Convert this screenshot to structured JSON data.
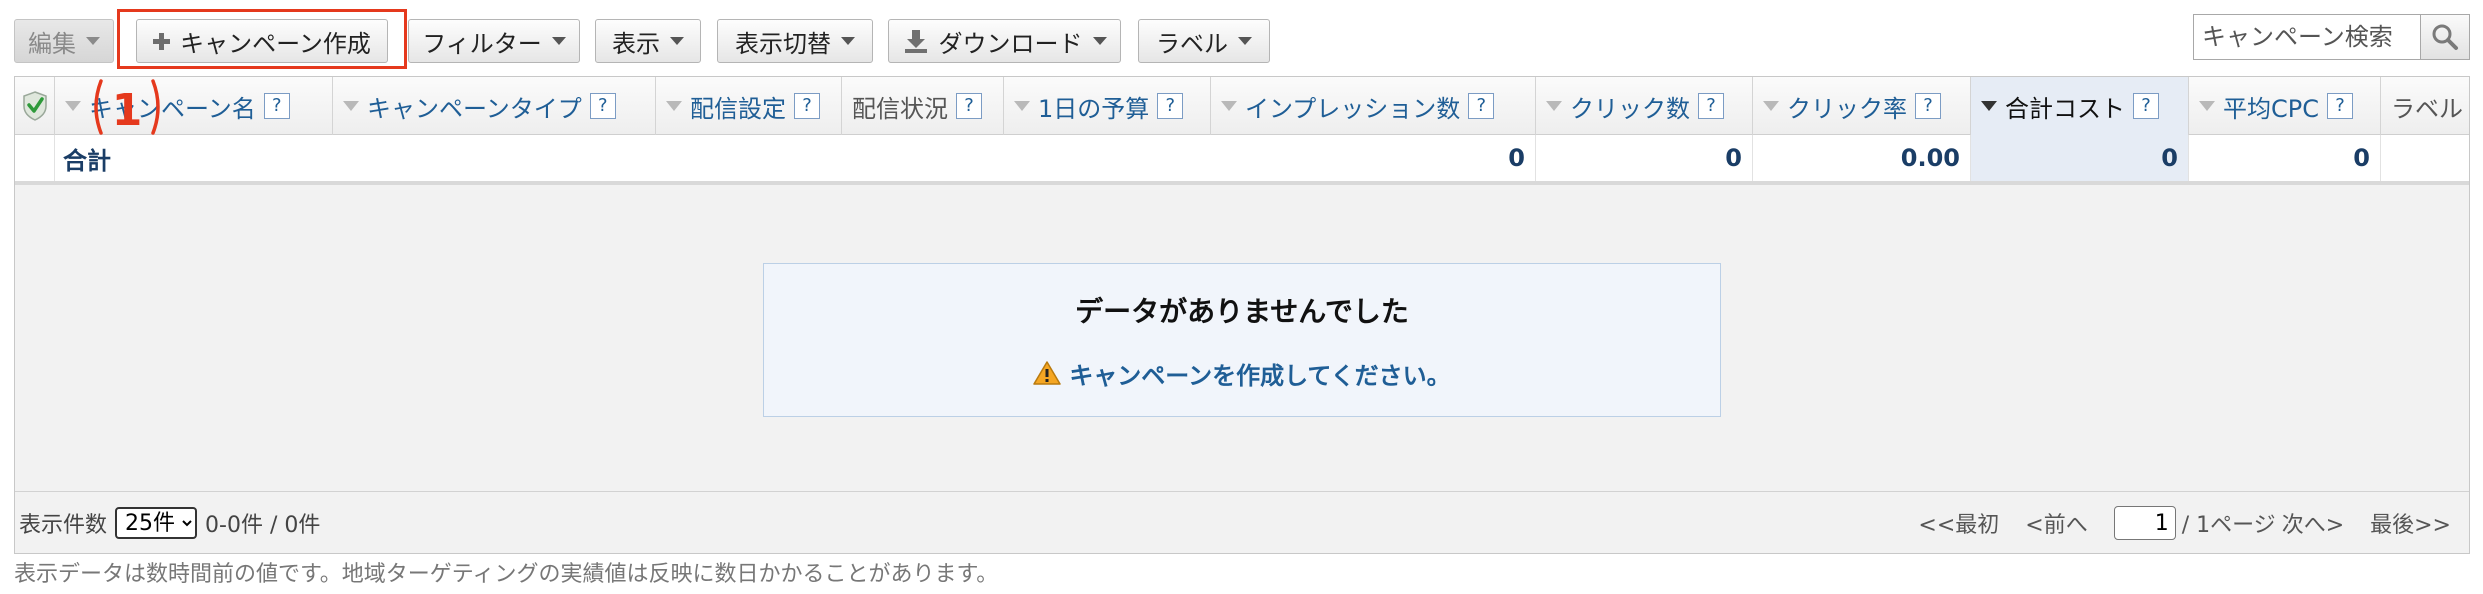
{
  "toolbar": {
    "edit_label": "編集",
    "create_campaign_label": "キャンペーン作成",
    "filter_label": "フィルター",
    "display_label": "表示",
    "view_switch_label": "表示切替",
    "download_label": "ダウンロード",
    "label_label": "ラベル",
    "search_placeholder": "キャンペーン検索"
  },
  "callout_number": "1",
  "columns": [
    {
      "label": "キャンペーン名",
      "help": "?"
    },
    {
      "label": "キャンペーンタイプ",
      "help": "?"
    },
    {
      "label": "配信設定",
      "help": "?"
    },
    {
      "label": "配信状況",
      "help": "?"
    },
    {
      "label": "1日の予算",
      "help": "?"
    },
    {
      "label": "インプレッション数",
      "help": "?"
    },
    {
      "label": "クリック数",
      "help": "?"
    },
    {
      "label": "クリック率",
      "help": "?"
    },
    {
      "label": "合計コスト",
      "help": "?"
    },
    {
      "label": "平均CPC",
      "help": "?"
    },
    {
      "label": "ラベル"
    }
  ],
  "totals": {
    "label": "合計",
    "impressions": "0",
    "clicks": "0",
    "ctr": "0.00",
    "cost": "0",
    "avg_cpc": "0"
  },
  "empty_state": {
    "title": "データがありませんでした",
    "message": "キャンペーンを作成してください。"
  },
  "footer": {
    "page_size_label": "表示件数",
    "page_size_value": "25件",
    "range_text": "0-0件 / 0件",
    "first_label": "<<最初",
    "prev_label": "<前へ",
    "page_value": "1",
    "page_total_text": "/ 1ページ",
    "next_label": "次へ>",
    "last_label": "最後>>"
  },
  "note": "表示データは数時間前の値です。地域ターゲティングの実績値は反映に数日かかることがあります。",
  "colors": {
    "link": "#1f5e96",
    "highlight": "#e5391d",
    "active_column": "#e6ecf5",
    "warning": "#f5a623"
  }
}
